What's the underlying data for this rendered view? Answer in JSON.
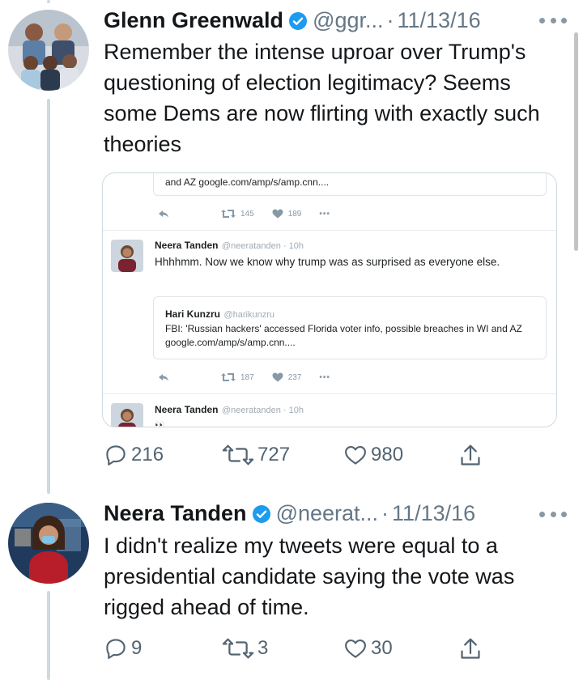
{
  "tweets": [
    {
      "author": "Glenn Greenwald",
      "handle": "@ggr...",
      "date": "11/13/16",
      "separator": "·",
      "text": "Remember the intense uproar over Trump's questioning of election legitimacy? Seems some Dems are now flirting with exactly such theories",
      "stats": {
        "replies": "216",
        "retweets": "727",
        "likes": "980"
      }
    },
    {
      "author": "Neera Tanden",
      "handle": "@neerat...",
      "date": "11/13/16",
      "separator": "·",
      "text": "I didn't realize my tweets were equal to a presidential candidate saying the vote was rigged ahead of time.",
      "stats": {
        "replies": "9",
        "retweets": "3",
        "likes": "30"
      }
    }
  ],
  "embed": {
    "top_quote_text": "and AZ  google.com/amp/s/amp.cnn....",
    "top_actions": {
      "retweets": "145",
      "likes": "189"
    },
    "item1": {
      "name": "Neera Tanden",
      "meta": "@neeratanden · 10h",
      "text": "Hhhhmm. Now we know why trump was as surprised as everyone else."
    },
    "quote": {
      "name": "Hari Kunzru",
      "meta": "@harikunzru",
      "text": "FBI: 'Russian hackers' accessed Florida voter info, possible breaches in WI and AZ  google.com/amp/s/amp.cnn...."
    },
    "item1_actions": {
      "retweets": "187",
      "likes": "237"
    },
    "item2": {
      "name": "Neera Tanden",
      "meta": "@neeratanden · 10h",
      "text": "👀"
    }
  },
  "colors": {
    "verified": "#1d9bf0",
    "secondary_text": "#657786",
    "thread_line": "#cfd9de"
  },
  "icons": [
    "verified-badge-icon",
    "more-icon",
    "reply-icon",
    "retweet-icon",
    "like-icon",
    "share-icon"
  ]
}
